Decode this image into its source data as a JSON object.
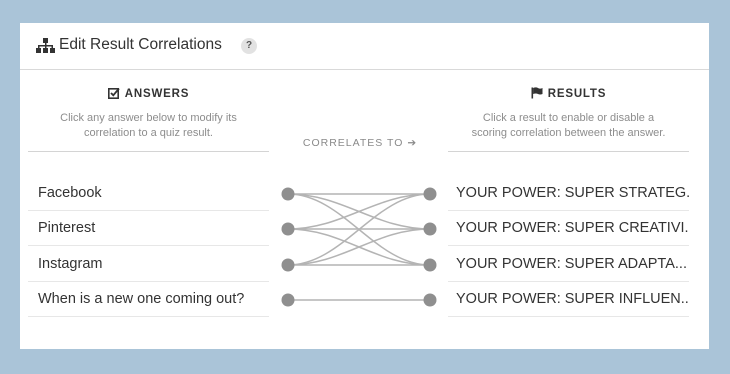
{
  "header": {
    "title": "Edit Result Correlations",
    "help_label": "?"
  },
  "answers": {
    "heading": "ANSWERS",
    "description_line1": "Click any answer below to modify its",
    "description_line2": "correlation to a quiz result.",
    "items": [
      {
        "label": "Facebook"
      },
      {
        "label": "Pinterest"
      },
      {
        "label": "Instagram"
      },
      {
        "label": "When is a new one coming out?"
      }
    ]
  },
  "correlates_label": "CORRELATES TO ➔",
  "results": {
    "heading": "RESULTS",
    "description_line1": "Click a result to enable or disable a",
    "description_line2": "scoring correlation between the answer.",
    "items": [
      {
        "label": "YOUR POWER: SUPER STRATEG..."
      },
      {
        "label": "YOUR POWER: SUPER CREATIVI..."
      },
      {
        "label": "YOUR POWER: SUPER ADAPTA..."
      },
      {
        "label": "YOUR POWER: SUPER INFLUEN..."
      }
    ]
  },
  "connections": [
    [
      0,
      0
    ],
    [
      0,
      1
    ],
    [
      0,
      2
    ],
    [
      1,
      0
    ],
    [
      1,
      1
    ],
    [
      1,
      2
    ],
    [
      2,
      0
    ],
    [
      2,
      1
    ],
    [
      2,
      2
    ],
    [
      3,
      3
    ]
  ],
  "colors": {
    "line": "#b4b4b4",
    "node": "#8f8f8f",
    "background": "#aac4d8"
  }
}
